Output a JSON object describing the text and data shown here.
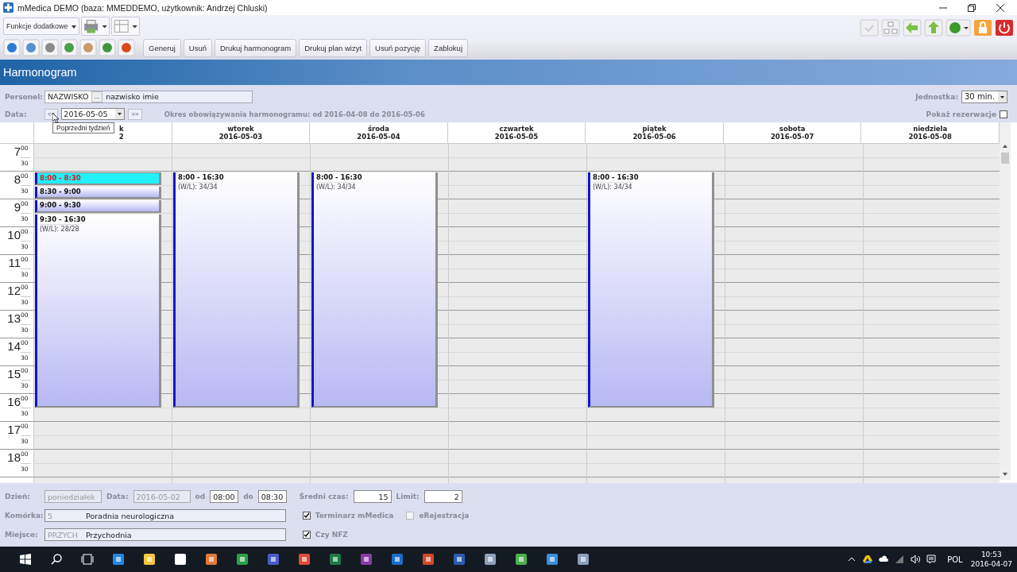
{
  "window": {
    "title": "mMedica DEMO (baza: MMEDDEMO, użytkownik: Andrzej Chluski)"
  },
  "toolbar": {
    "dropdown": "Funkcje dodatkowe",
    "buttons": [
      "Generuj",
      "Usuń",
      "Drukuj harmonogram",
      "Drukuj plan wizyt",
      "Usuń pozycję",
      "Zablokuj"
    ]
  },
  "section_title": "Harmonogram",
  "filters": {
    "personel_label": "Personel:",
    "personel_code": "NAZWISKO",
    "personel_more": "...",
    "personel_name": "nazwisko imie",
    "data_label": "Data:",
    "prev": "<<",
    "date": "2016-05-05",
    "next": ">>",
    "period": "Okres obowiązywania harmonogramu: od 2016-04-08 do 2016-05-06",
    "unit_label": "Jednostka:",
    "unit": "30 min.",
    "reservations_label": "Pokaż rezerwacje",
    "reservations": false,
    "tooltip": "Poprzedni tydzień"
  },
  "hours": [
    {
      "hour": "7",
      "full": "00",
      "half": "30"
    },
    {
      "hour": "8",
      "full": "00",
      "half": "30"
    },
    {
      "hour": "9",
      "full": "00",
      "half": "30"
    },
    {
      "hour": "10",
      "full": "00",
      "half": "30"
    },
    {
      "hour": "11",
      "full": "00",
      "half": "30"
    },
    {
      "hour": "12",
      "full": "00",
      "half": "30"
    },
    {
      "hour": "13",
      "full": "00",
      "half": "30"
    },
    {
      "hour": "14",
      "full": "00",
      "half": "30"
    },
    {
      "hour": "15",
      "full": "00",
      "half": "30"
    },
    {
      "hour": "16",
      "full": "00",
      "half": "30"
    },
    {
      "hour": "17",
      "full": "00",
      "half": "30"
    },
    {
      "hour": "18",
      "full": "00",
      "half": "30"
    }
  ],
  "days": [
    {
      "name": "k",
      "date": "2",
      "covered": true,
      "events": [
        {
          "time": "8:00 - 8:30",
          "selected": true
        },
        {
          "time": "8:30 - 9:00",
          "selected": false
        },
        {
          "time": "9:00 - 9:30",
          "selected": false
        },
        {
          "time": "9:30 - 16:30",
          "info": "(W/L): 28/28",
          "selected": false
        }
      ]
    },
    {
      "name": "wtorek",
      "date": "2016-05-03",
      "covered": false,
      "events": [
        {
          "time": "8:00 - 16:30",
          "info": "(W/L): 34/34",
          "selected": false
        }
      ]
    },
    {
      "name": "środa",
      "date": "2016-05-04",
      "covered": false,
      "events": [
        {
          "time": "8:00 - 16:30",
          "info": "(W/L): 34/34",
          "selected": false
        }
      ]
    },
    {
      "name": "czwartek",
      "date": "2016-05-05",
      "covered": false
    },
    {
      "name": "piątek",
      "date": "2016-05-06",
      "covered": false,
      "events": [
        {
          "time": "8:00 - 16:30",
          "info": "(W/L): 34/34",
          "selected": false
        }
      ]
    },
    {
      "name": "sobota",
      "date": "2016-05-07",
      "covered": false
    },
    {
      "name": "niedziela",
      "date": "2016-05-08",
      "covered": false
    }
  ],
  "form": {
    "day_label": "Dzień:",
    "day": "poniedziałek",
    "date_label": "Data:",
    "date": "2016-05-02",
    "from_label": "od",
    "from": "08:00",
    "to_label": "do",
    "to": "08:30",
    "avg_label": "Średni czas:",
    "avg": "15",
    "limit_label": "Limit:",
    "limit": "2",
    "unit_label": "Komórka:",
    "unit_code": "5",
    "unit_name": "Poradnia neurologiczna",
    "place_label": "Miejsce:",
    "place_code": "PRZYCH",
    "place_name": "Przychodnia",
    "checks": [
      {
        "label": "Terminarz mMedica",
        "checked": true,
        "disabled": false
      },
      {
        "label": "eRejestracja",
        "checked": false,
        "disabled": true
      },
      {
        "label": "Czy NFZ",
        "checked": true,
        "disabled": false
      }
    ]
  },
  "taskbar": {
    "language": "POL",
    "time": "10:53",
    "date": "2016-04-07"
  }
}
